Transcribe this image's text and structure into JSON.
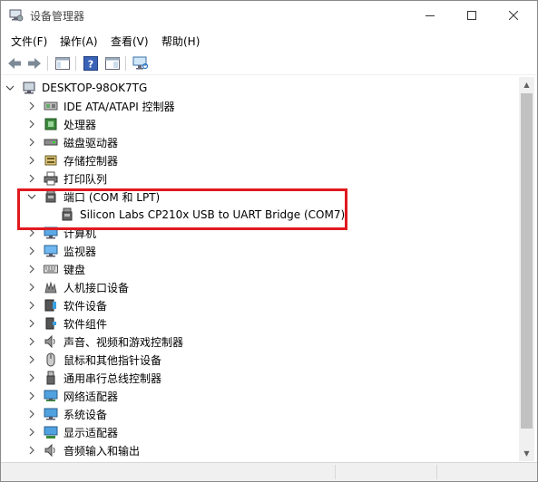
{
  "window": {
    "title": "设备管理器"
  },
  "menu": [
    {
      "label": "文件(F)"
    },
    {
      "label": "操作(A)"
    },
    {
      "label": "查看(V)"
    },
    {
      "label": "帮助(H)"
    }
  ],
  "tree": {
    "root": "DESKTOP-98OK7TG",
    "items": [
      {
        "label": "IDE ATA/ATAPI 控制器",
        "icon": "ide-controller-icon"
      },
      {
        "label": "处理器",
        "icon": "processor-icon"
      },
      {
        "label": "磁盘驱动器",
        "icon": "disk-drive-icon"
      },
      {
        "label": "存储控制器",
        "icon": "storage-controller-icon"
      },
      {
        "label": "打印队列",
        "icon": "printer-icon"
      },
      {
        "label": "端口 (COM 和 LPT)",
        "icon": "port-icon",
        "expanded": true,
        "children": [
          {
            "label": "Silicon Labs CP210x USB to UART Bridge (COM7)",
            "icon": "port-icon"
          }
        ]
      },
      {
        "label": "计算机",
        "icon": "computer-icon"
      },
      {
        "label": "监视器",
        "icon": "monitor-icon"
      },
      {
        "label": "键盘",
        "icon": "keyboard-icon"
      },
      {
        "label": "人机接口设备",
        "icon": "hid-icon"
      },
      {
        "label": "软件设备",
        "icon": "software-device-icon"
      },
      {
        "label": "软件组件",
        "icon": "software-component-icon"
      },
      {
        "label": "声音、视频和游戏控制器",
        "icon": "speaker-icon"
      },
      {
        "label": "鼠标和其他指针设备",
        "icon": "mouse-icon"
      },
      {
        "label": "通用串行总线控制器",
        "icon": "usb-icon"
      },
      {
        "label": "网络适配器",
        "icon": "network-adapter-icon"
      },
      {
        "label": "系统设备",
        "icon": "system-device-icon"
      },
      {
        "label": "显示适配器",
        "icon": "display-adapter-icon"
      },
      {
        "label": "音频输入和输出",
        "icon": "audio-io-icon"
      }
    ]
  },
  "colors": {
    "highlight": "#e0191f",
    "icon_blue": "#2b79c9"
  }
}
